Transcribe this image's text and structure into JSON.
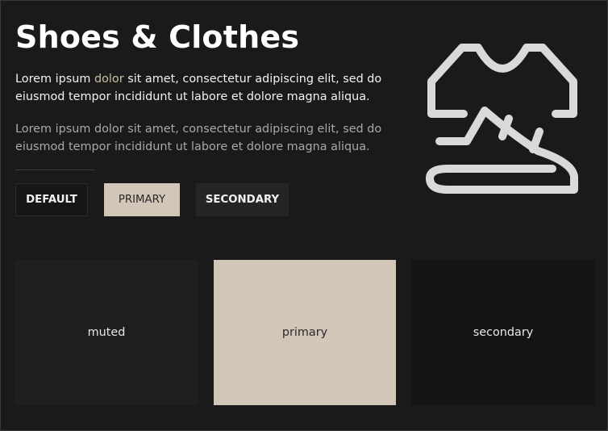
{
  "hero": {
    "title": "Shoes & Clothes",
    "paragraph1": {
      "before": "Lorem ipsum ",
      "link": "dolor",
      "after": " sit amet, consectetur adipiscing elit, sed do eiusmod tempor incididunt ut labore et dolore magna aliqua."
    },
    "paragraph2": "Lorem ipsum dolor sit amet, consectetur adipiscing elit, sed do eiusmod tempor incididunt ut labore et dolore magna aliqua.",
    "illustration_icon": "shoes-clothes-icon"
  },
  "buttons": {
    "default_label": "DEFAULT",
    "primary_label": "PRIMARY",
    "secondary_label": "SECONDARY"
  },
  "cards": {
    "muted_label": "muted",
    "primary_label": "primary",
    "secondary_label": "secondary"
  },
  "colors": {
    "background": "#1a1a1a",
    "primary": "#d2c6b8",
    "muted": "#211f1d",
    "secondary": "#141414",
    "accent_text": "#cbbfa6"
  }
}
